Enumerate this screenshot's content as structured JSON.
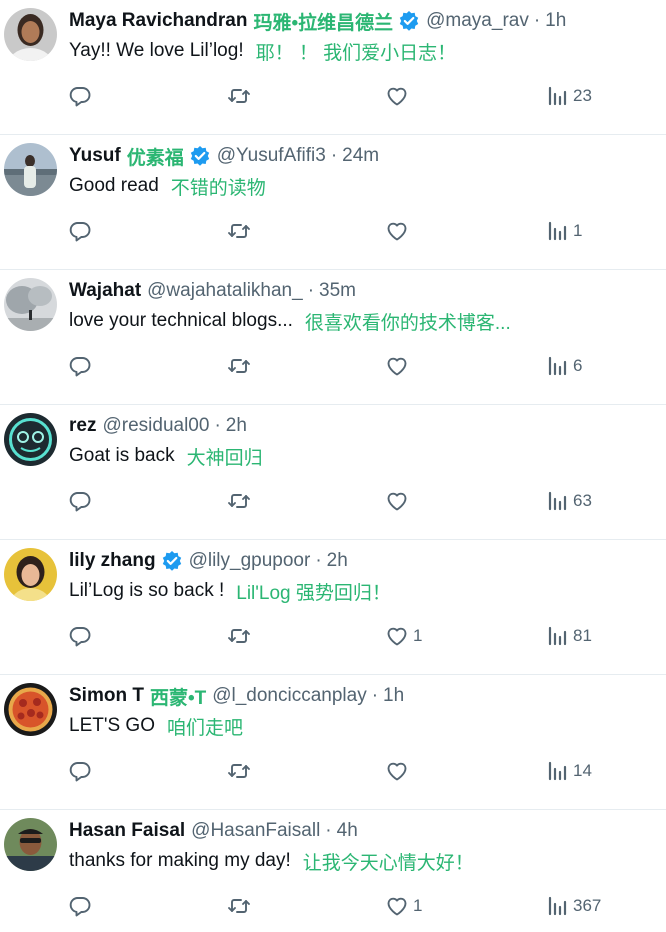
{
  "colors": {
    "translation": "#2bb673",
    "verified": "#1d9bf0",
    "muted": "#536471"
  },
  "icons": {
    "reply": "reply-icon",
    "retweet": "retweet-icon",
    "like": "heart-icon",
    "views": "views-icon",
    "verified": "verified-badge-icon"
  },
  "tweets": [
    {
      "name": "Maya Ravichandran",
      "name_tr": "玛雅•拉维昌德兰",
      "verified": true,
      "handle": "@maya_rav",
      "dot": "·",
      "time": "1h",
      "text": "Yay!! We love Lil’log!",
      "text_tr": "耶！ ！ 我们爱小日志！",
      "likes": "",
      "views": "23"
    },
    {
      "name": "Yusuf",
      "name_tr": "优素福",
      "verified": true,
      "handle": "@YusufAfifi3",
      "dot": "·",
      "time": "24m",
      "text": "Good read",
      "text_tr": "不错的读物",
      "likes": "",
      "views": "1"
    },
    {
      "name": "Wajahat",
      "name_tr": "",
      "verified": false,
      "handle": "@wajahatalikhan_",
      "dot": "·",
      "time": "35m",
      "text": "love your technical blogs...",
      "text_tr": "很喜欢看你的技术博客...",
      "likes": "",
      "views": "6"
    },
    {
      "name": "rez",
      "name_tr": "",
      "verified": false,
      "handle": "@residual00",
      "dot": "·",
      "time": "2h",
      "text": "Goat is back",
      "text_tr": "大神回归",
      "likes": "",
      "views": "63"
    },
    {
      "name": "lily zhang",
      "name_tr": "",
      "verified": true,
      "handle": "@lily_gpupoor",
      "dot": "·",
      "time": "2h",
      "text": "Lil’Log is so back !",
      "text_tr": "Lil'Log 强势回归！",
      "likes": "1",
      "views": "81"
    },
    {
      "name": "Simon T",
      "name_tr": "西蒙•T",
      "verified": false,
      "handle": "@l_donciccanplay",
      "dot": "·",
      "time": "1h",
      "text": "LET'S GO",
      "text_tr": "咱们走吧",
      "likes": "",
      "views": "14"
    },
    {
      "name": "Hasan Faisal",
      "name_tr": "",
      "verified": false,
      "handle": "@HasanFaisall",
      "dot": "·",
      "time": "4h",
      "text": "thanks for making my day!",
      "text_tr": "让我今天心情大好！",
      "likes": "1",
      "views": "367"
    }
  ]
}
